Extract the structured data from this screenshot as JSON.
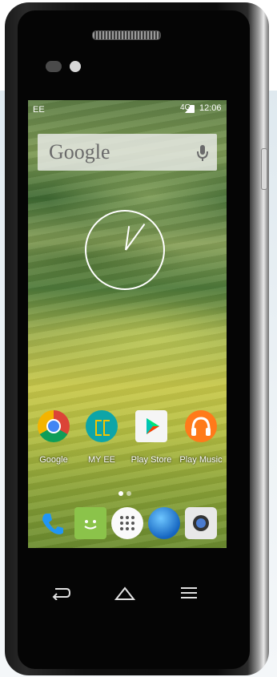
{
  "status": {
    "carrier": "EE",
    "network": "4G",
    "time": "12:06"
  },
  "search": {
    "logo_text": "Google"
  },
  "apps": [
    {
      "label": "Google",
      "icon": "chrome-icon"
    },
    {
      "label": "MY EE",
      "icon": "ee-icon"
    },
    {
      "label": "Play Store",
      "icon": "play-store-icon"
    },
    {
      "label": "Play Music",
      "icon": "headphones-icon"
    }
  ],
  "dock": [
    {
      "icon": "phone-icon"
    },
    {
      "icon": "messaging-icon"
    },
    {
      "icon": "app-drawer-icon"
    },
    {
      "icon": "browser-globe-icon"
    },
    {
      "icon": "camera-icon"
    }
  ],
  "nav": {
    "back": "back-icon",
    "home": "home-icon",
    "menu": "menu-icon"
  },
  "colors": {
    "ee_teal": "#0da5a8",
    "chrome_red": "#db4437",
    "chrome_yellow": "#f4b400",
    "chrome_green": "#0f9d58",
    "chrome_blue": "#4285f4",
    "music_orange": "#ff7a1a"
  }
}
